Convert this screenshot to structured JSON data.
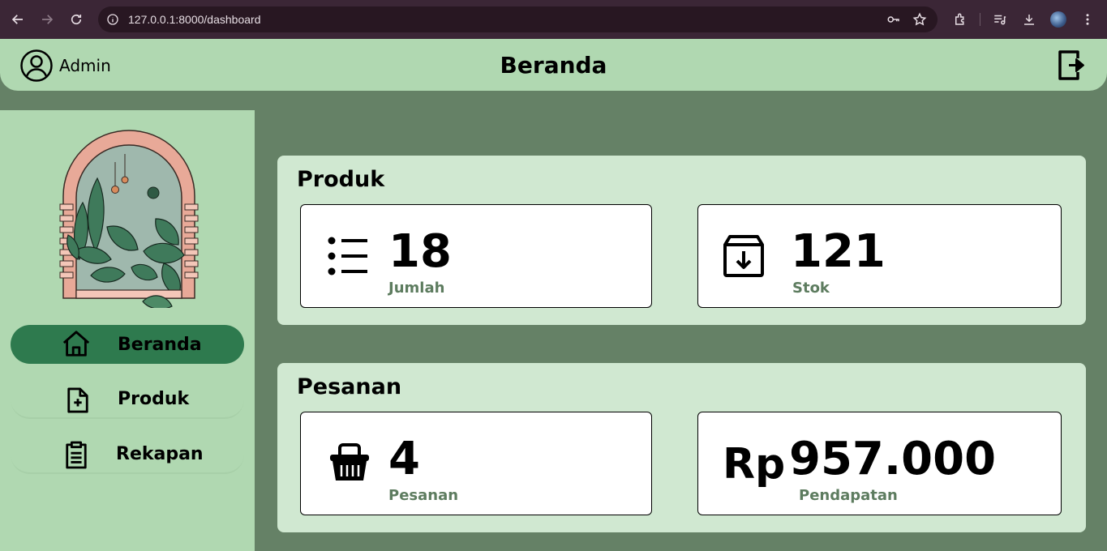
{
  "browser": {
    "url": "127.0.0.1:8000/dashboard"
  },
  "header": {
    "user_name": "Admin",
    "title": "Beranda"
  },
  "sidebar": {
    "items": [
      {
        "label": "Beranda",
        "icon": "home-icon",
        "active": true
      },
      {
        "label": "Produk",
        "icon": "file-plus-icon",
        "active": false
      },
      {
        "label": "Rekapan",
        "icon": "clipboard-icon",
        "active": false
      }
    ]
  },
  "sections": {
    "produk": {
      "title": "Produk",
      "cards": [
        {
          "value": "18",
          "label": "Jumlah",
          "icon": "list-icon"
        },
        {
          "value": "121",
          "label": "Stok",
          "icon": "archive-download-icon"
        }
      ]
    },
    "pesanan": {
      "title": "Pesanan",
      "cards": [
        {
          "value": "4",
          "label": "Pesanan",
          "icon": "basket-icon"
        },
        {
          "value": "957.000",
          "label": "Pendapatan",
          "icon": "rupiah-icon",
          "currency": "Rp"
        }
      ]
    }
  },
  "colors": {
    "page_bg": "#658166",
    "header_bg": "#b0d8b1",
    "section_bg": "#d0e8d1",
    "active_nav": "#2e7a4e",
    "label_text": "#5d7c5f"
  }
}
